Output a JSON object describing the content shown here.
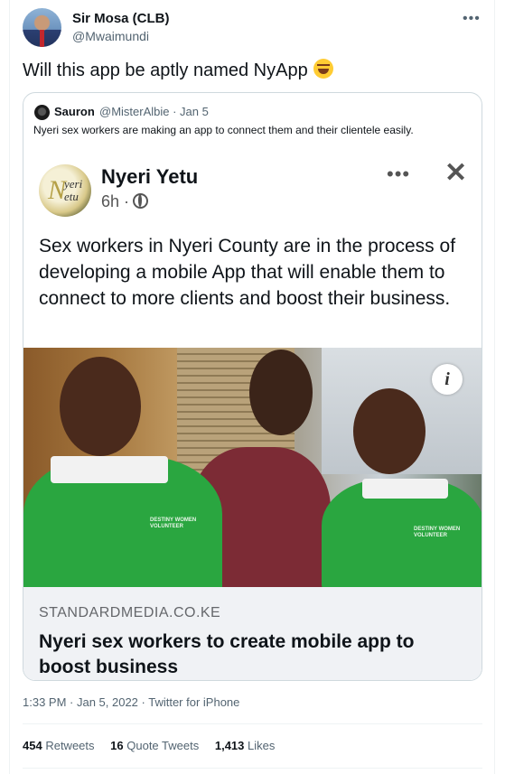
{
  "tweet": {
    "author_name": "Sir Mosa (CLB)",
    "author_handle": "@Mwaimundi",
    "more_icon": "more-horizontal-icon",
    "text": "Will this app be aptly named NyApp",
    "emoji": "tears-of-joy-emoji"
  },
  "quote": {
    "author_name": "Sauron",
    "author_meta": "@MisterAlbie · Jan 5",
    "text": "Nyeri sex workers are making an app to connect them and their clientele easily.",
    "screenshot": {
      "page_name": "Nyeri Yetu",
      "logo_text": [
        "N",
        "yeri",
        "etu"
      ],
      "time": "6h ·",
      "body": "Sex workers in Nyeri County are in the process of developing a mobile App that will enable them to connect to more clients and boost their business.",
      "link_domain": "STANDARDMEDIA.CO.KE",
      "link_title": "Nyeri sex workers to create mobile app to boost business",
      "shirt_print_1": "DESTINY WOMEN VOLUNTEER",
      "shirt_print_2": "DESTINY WOMEN VOLUNTEER"
    }
  },
  "timestamp": "1:33 PM · Jan 5, 2022 · Twitter for iPhone",
  "stats": [
    {
      "count": "454",
      "label": "Retweets"
    },
    {
      "count": "16",
      "label": "Quote Tweets"
    },
    {
      "count": "1,413",
      "label": "Likes"
    }
  ]
}
